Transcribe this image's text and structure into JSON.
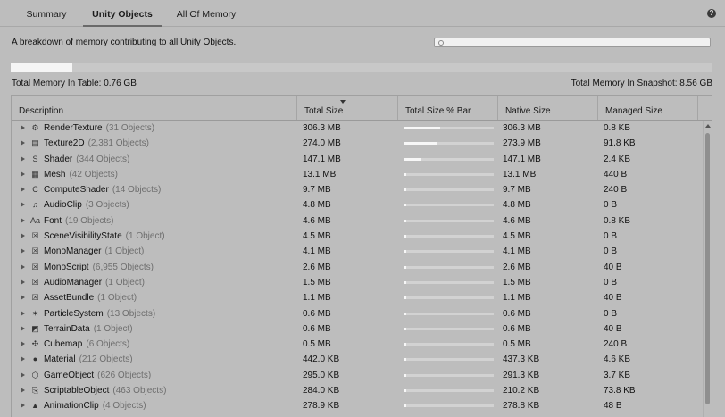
{
  "tabs": [
    {
      "label": "Summary",
      "active": false
    },
    {
      "label": "Unity Objects",
      "active": true
    },
    {
      "label": "All Of Memory",
      "active": false
    }
  ],
  "header": {
    "description": "A breakdown of memory contributing to all Unity Objects.",
    "search_value": "",
    "total_memory_table": "Total Memory In Table: 0.76 GB",
    "total_memory_snapshot": "Total Memory In Snapshot: 8.56 GB",
    "table_fraction_of_snapshot": 0.088
  },
  "table": {
    "columns": [
      "Description",
      "Total Size",
      "Total Size % Bar",
      "Native Size",
      "Managed Size"
    ],
    "sorted_column": "Total Size",
    "rows": [
      {
        "icon": "render-texture-icon",
        "glyph": "⚙",
        "name": "RenderTexture",
        "count": "(31 Objects)",
        "total": "306.3 MB",
        "pct": 0.4,
        "native": "306.3 MB",
        "managed": "0.8 KB"
      },
      {
        "icon": "texture2d-icon",
        "glyph": "▤",
        "name": "Texture2D",
        "count": "(2,381 Objects)",
        "total": "274.0 MB",
        "pct": 0.36,
        "native": "273.9 MB",
        "managed": "91.8 KB"
      },
      {
        "icon": "shader-icon",
        "glyph": "S",
        "name": "Shader",
        "count": "(344 Objects)",
        "total": "147.1 MB",
        "pct": 0.19,
        "native": "147.1 MB",
        "managed": "2.4 KB"
      },
      {
        "icon": "mesh-icon",
        "glyph": "▦",
        "name": "Mesh",
        "count": "(42 Objects)",
        "total": "13.1 MB",
        "pct": 0.017,
        "native": "13.1 MB",
        "managed": "440 B"
      },
      {
        "icon": "compute-shader-icon",
        "glyph": "C",
        "name": "ComputeShader",
        "count": "(14 Objects)",
        "total": "9.7 MB",
        "pct": 0.013,
        "native": "9.7 MB",
        "managed": "240 B"
      },
      {
        "icon": "audio-clip-icon",
        "glyph": "♫",
        "name": "AudioClip",
        "count": "(3 Objects)",
        "total": "4.8 MB",
        "pct": 0.006,
        "native": "4.8 MB",
        "managed": "0 B"
      },
      {
        "icon": "font-icon",
        "glyph": "Aa",
        "name": "Font",
        "count": "(19 Objects)",
        "total": "4.6 MB",
        "pct": 0.006,
        "native": "4.6 MB",
        "managed": "0.8 KB"
      },
      {
        "icon": "generic-object-icon",
        "glyph": "☒",
        "name": "SceneVisibilityState",
        "count": "(1 Object)",
        "total": "4.5 MB",
        "pct": 0.006,
        "native": "4.5 MB",
        "managed": "0 B"
      },
      {
        "icon": "generic-object-icon",
        "glyph": "☒",
        "name": "MonoManager",
        "count": "(1 Object)",
        "total": "4.1 MB",
        "pct": 0.005,
        "native": "4.1 MB",
        "managed": "0 B"
      },
      {
        "icon": "generic-object-icon",
        "glyph": "☒",
        "name": "MonoScript",
        "count": "(6,955 Objects)",
        "total": "2.6 MB",
        "pct": 0.003,
        "native": "2.6 MB",
        "managed": "40 B"
      },
      {
        "icon": "generic-object-icon",
        "glyph": "☒",
        "name": "AudioManager",
        "count": "(1 Object)",
        "total": "1.5 MB",
        "pct": 0.002,
        "native": "1.5 MB",
        "managed": "0 B"
      },
      {
        "icon": "generic-object-icon",
        "glyph": "☒",
        "name": "AssetBundle",
        "count": "(1 Object)",
        "total": "1.1 MB",
        "pct": 0.0015,
        "native": "1.1 MB",
        "managed": "40 B"
      },
      {
        "icon": "particle-system-icon",
        "glyph": "✶",
        "name": "ParticleSystem",
        "count": "(13 Objects)",
        "total": "0.6 MB",
        "pct": 0.001,
        "native": "0.6 MB",
        "managed": "0 B"
      },
      {
        "icon": "terrain-data-icon",
        "glyph": "◩",
        "name": "TerrainData",
        "count": "(1 Object)",
        "total": "0.6 MB",
        "pct": 0.001,
        "native": "0.6 MB",
        "managed": "40 B"
      },
      {
        "icon": "cubemap-icon",
        "glyph": "✣",
        "name": "Cubemap",
        "count": "(6 Objects)",
        "total": "0.5 MB",
        "pct": 0.001,
        "native": "0.5 MB",
        "managed": "240 B"
      },
      {
        "icon": "material-icon",
        "glyph": "●",
        "name": "Material",
        "count": "(212 Objects)",
        "total": "442.0 KB",
        "pct": 0.001,
        "native": "437.3 KB",
        "managed": "4.6 KB"
      },
      {
        "icon": "game-object-icon",
        "glyph": "⬡",
        "name": "GameObject",
        "count": "(626 Objects)",
        "total": "295.0 KB",
        "pct": 0.001,
        "native": "291.3 KB",
        "managed": "3.7 KB"
      },
      {
        "icon": "scriptable-object-icon",
        "glyph": "⎘",
        "name": "ScriptableObject",
        "count": "(463 Objects)",
        "total": "284.0 KB",
        "pct": 0.001,
        "native": "210.2 KB",
        "managed": "73.8 KB"
      },
      {
        "icon": "animation-clip-icon",
        "glyph": "▲",
        "name": "AnimationClip",
        "count": "(4 Objects)",
        "total": "278.9 KB",
        "pct": 0.001,
        "native": "278.8 KB",
        "managed": "48 B"
      }
    ]
  }
}
